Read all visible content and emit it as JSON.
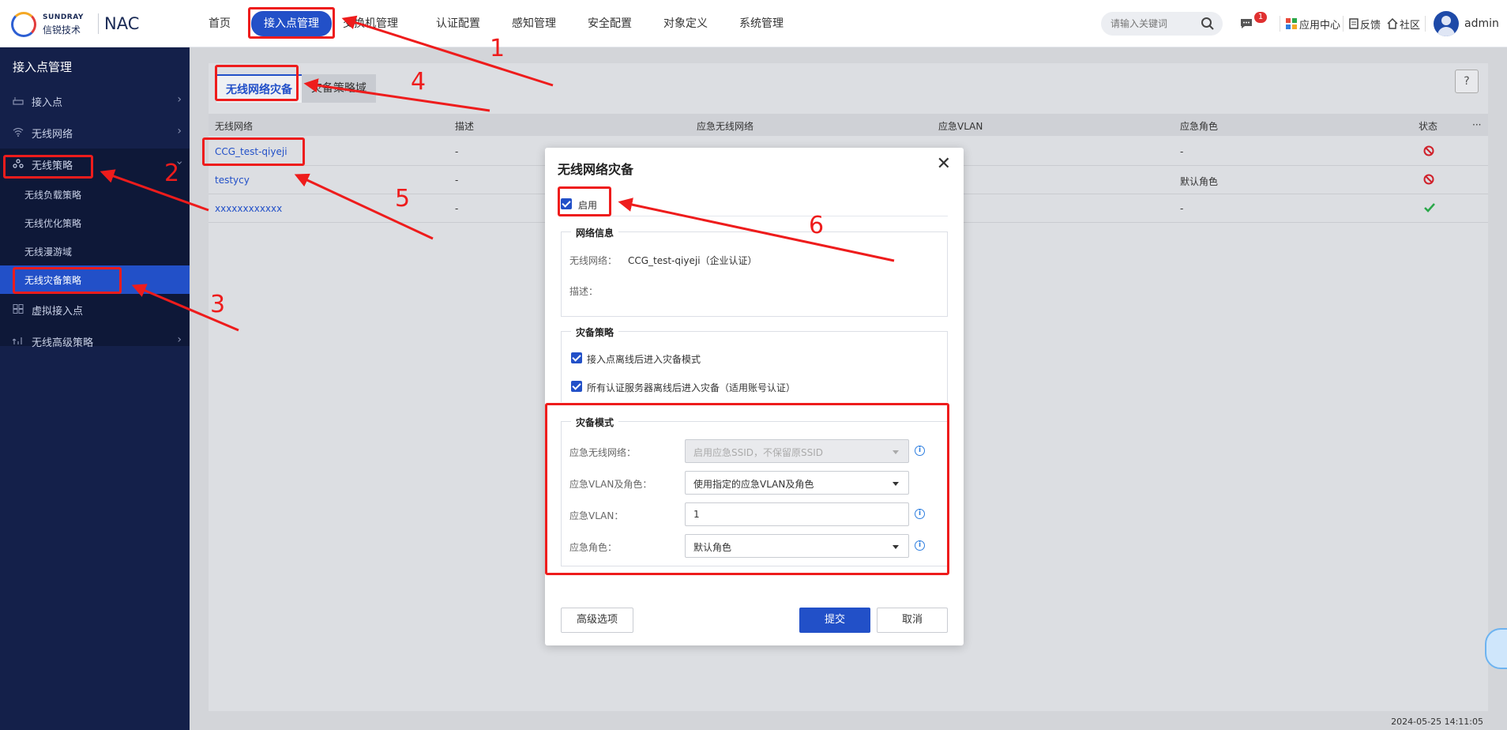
{
  "brand": {
    "en": "SUNDRAY",
    "cn": "信锐技术",
    "product": "NAC"
  },
  "topnav": [
    "首页",
    "接入点管理",
    "交换机管理",
    "认证配置",
    "感知管理",
    "安全配置",
    "对象定义",
    "系统管理"
  ],
  "search": {
    "placeholder": "请输入关键词"
  },
  "toolbar": {
    "msg_badge": "1",
    "app_center": "应用中心",
    "feedback": "反馈",
    "community": "社区",
    "user": "admin"
  },
  "sidebar": {
    "title": "接入点管理",
    "items": [
      {
        "label": "接入点",
        "icon": "router-icon"
      },
      {
        "label": "无线网络",
        "icon": "wifi-icon"
      },
      {
        "label": "无线策略",
        "icon": "strategy-icon"
      },
      {
        "label": "虚拟接入点",
        "icon": "grid-icon"
      },
      {
        "label": "无线高级策略",
        "icon": "advanced-icon"
      }
    ],
    "sub_items": [
      "无线负载策略",
      "无线优化策略",
      "无线漫游域",
      "无线灾备策略"
    ]
  },
  "tabs": [
    "无线网络灾备",
    "灾备策略域"
  ],
  "table": {
    "headers": [
      "无线网络",
      "描述",
      "应急无线网络",
      "应急VLAN",
      "应急角色",
      "状态",
      "···"
    ],
    "rows": [
      {
        "network": "CCG_test-qiyeji",
        "desc": "-",
        "role": "-",
        "status": "disabled"
      },
      {
        "network": "testycy",
        "desc": "-",
        "role": "默认角色",
        "status": "disabled"
      },
      {
        "network": "xxxxxxxxxxxx",
        "desc": "-",
        "role": "-",
        "status": "enabled"
      }
    ]
  },
  "modal": {
    "title": "无线网络灾备",
    "enable_label": "启用",
    "network_info": {
      "legend": "网络信息",
      "network_label": "无线网络：",
      "network_value": "CCG_test-qiyeji（企业认证）",
      "desc_label": "描述："
    },
    "strategy": {
      "legend": "灾备策略",
      "opt1": "接入点离线后进入灾备模式",
      "opt2": "所有认证服务器离线后进入灾备（适用账号认证）"
    },
    "mode": {
      "legend": "灾备模式",
      "ssid_label": "应急无线网络：",
      "ssid_value": "启用应急SSID，不保留原SSID",
      "vlan_role_label": "应急VLAN及角色：",
      "vlan_role_value": "使用指定的应急VLAN及角色",
      "vlan_label": "应急VLAN：",
      "vlan_value": "1",
      "role_label": "应急角色：",
      "role_value": "默认角色"
    },
    "buttons": {
      "advanced": "高级选项",
      "submit": "提交",
      "cancel": "取消"
    }
  },
  "annotations": [
    "1",
    "2",
    "3",
    "4",
    "5",
    "6"
  ],
  "footer": {
    "timestamp": "2024-05-25 14:11:05"
  },
  "colors": {
    "primary": "#2250c8",
    "sidebar": "#14204a",
    "annotation": "#ee1c1c",
    "error": "#d0202a",
    "success": "#2aa84a"
  }
}
